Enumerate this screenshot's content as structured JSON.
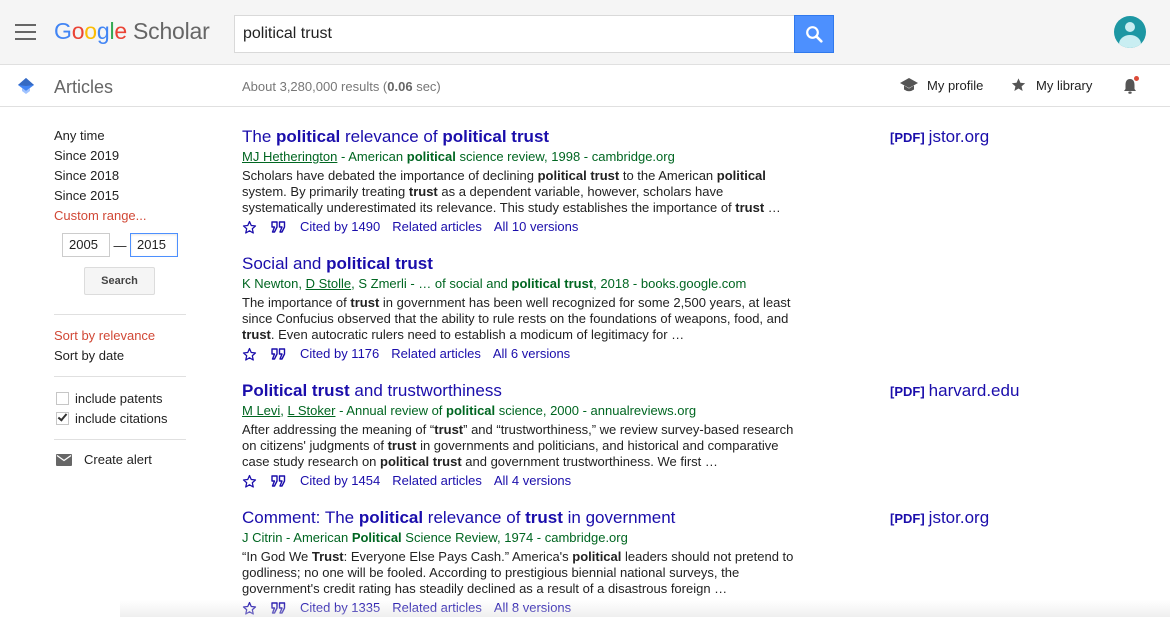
{
  "header": {
    "logo_google": [
      "G",
      "o",
      "o",
      "g",
      "l",
      "e"
    ],
    "logo_scholar": "Scholar",
    "search_value": "political trust"
  },
  "subbar": {
    "section": "Articles",
    "results_prefix": "About 3,280,000 results (",
    "results_time": "0.06",
    "results_suffix": " sec)",
    "my_profile": "My profile",
    "my_library": "My library"
  },
  "sidebar": {
    "time_filters": [
      "Any time",
      "Since 2019",
      "Since 2018",
      "Since 2015"
    ],
    "custom_range": "Custom range...",
    "year_from": "2005",
    "year_to": "2015",
    "search_button": "Search",
    "sort_relevance": "Sort by relevance",
    "sort_date": "Sort by date",
    "include_patents": "include patents",
    "include_patents_checked": false,
    "include_citations": "include citations",
    "include_citations_checked": true,
    "create_alert": "Create alert"
  },
  "results": [
    {
      "title": [
        [
          "The ",
          false
        ],
        [
          "political",
          true
        ],
        [
          " relevance of ",
          false
        ],
        [
          "political trust",
          true
        ]
      ],
      "meta": [
        [
          "MJ Hetherington",
          "u"
        ],
        [
          " - American ",
          ""
        ],
        [
          "political",
          "b"
        ],
        [
          " science review, 1998 - cambridge.org",
          ""
        ]
      ],
      "snippet": [
        [
          "Scholars have debated the importance of declining ",
          false
        ],
        [
          "political trust",
          true
        ],
        [
          " to the American ",
          false
        ],
        [
          "political",
          true
        ],
        [
          " system. By primarily treating ",
          false
        ],
        [
          "trust",
          true
        ],
        [
          " as a dependent variable, however, scholars have systematically underestimated its relevance. This study establishes the importance of ",
          false
        ],
        [
          "trust",
          true
        ],
        [
          " …",
          false
        ]
      ],
      "cited_by": "Cited by 1490",
      "related": "Related articles",
      "versions": "All 10 versions",
      "pdf_tag": "[PDF]",
      "pdf_source": "jstor.org"
    },
    {
      "title": [
        [
          "Social and ",
          false
        ],
        [
          "political trust",
          true
        ]
      ],
      "meta": [
        [
          "K Newton",
          ""
        ],
        [
          ", ",
          ""
        ],
        [
          "D Stolle",
          "u"
        ],
        [
          ", S Zmerli - … of social and ",
          ""
        ],
        [
          "political trust",
          "b"
        ],
        [
          ", 2018 - books.google.com",
          ""
        ]
      ],
      "snippet": [
        [
          "The importance of ",
          false
        ],
        [
          "trust",
          true
        ],
        [
          " in government has been well recognized for some 2,500 years, at least since Confucius observed that the ability to rule rests on the foundations of weapons, food, and ",
          false
        ],
        [
          "trust",
          true
        ],
        [
          ". Even autocratic rulers need to establish a modicum of legitimacy for …",
          false
        ]
      ],
      "cited_by": "Cited by 1176",
      "related": "Related articles",
      "versions": "All 6 versions",
      "pdf_tag": "",
      "pdf_source": ""
    },
    {
      "title": [
        [
          "Political trust",
          true
        ],
        [
          " and trustworthiness",
          false
        ]
      ],
      "meta": [
        [
          "M Levi",
          "u"
        ],
        [
          ", ",
          ""
        ],
        [
          "L Stoker",
          "u"
        ],
        [
          " - Annual review of ",
          ""
        ],
        [
          "political",
          "b"
        ],
        [
          " science, 2000 - annualreviews.org",
          ""
        ]
      ],
      "snippet": [
        [
          "After addressing the meaning of “",
          false
        ],
        [
          "trust",
          true
        ],
        [
          "” and “trustworthiness,” we review survey-based research on citizens' judgments of ",
          false
        ],
        [
          "trust",
          true
        ],
        [
          " in governments and politicians, and historical and comparative case study research on ",
          false
        ],
        [
          "political trust",
          true
        ],
        [
          " and government trustworthiness. We first …",
          false
        ]
      ],
      "cited_by": "Cited by 1454",
      "related": "Related articles",
      "versions": "All 4 versions",
      "pdf_tag": "[PDF]",
      "pdf_source": "harvard.edu"
    },
    {
      "title": [
        [
          "Comment: The ",
          false
        ],
        [
          "political",
          true
        ],
        [
          " relevance of ",
          false
        ],
        [
          "trust",
          true
        ],
        [
          " in government",
          false
        ]
      ],
      "meta": [
        [
          "J Citrin - American ",
          ""
        ],
        [
          "Political",
          "b"
        ],
        [
          " Science Review, 1974 - cambridge.org",
          ""
        ]
      ],
      "snippet": [
        [
          "“In God We ",
          false
        ],
        [
          "Trust",
          true
        ],
        [
          ": Everyone Else Pays Cash.” America's ",
          false
        ],
        [
          "political",
          true
        ],
        [
          " leaders should not pretend to godliness; no one will be fooled. According to prestigious biennial national surveys, the government's credit rating has steadily declined as a result of a disastrous foreign …",
          false
        ]
      ],
      "cited_by": "Cited by 1335",
      "related": "Related articles",
      "versions": "All 8 versions",
      "pdf_tag": "[PDF]",
      "pdf_source": "jstor.org"
    }
  ],
  "colors": {
    "link": "#1a0dab",
    "meta_green": "#006621",
    "accent_red": "#d14836",
    "search_blue": "#4d90fe"
  },
  "icons": {
    "menu": "hamburger-icon",
    "search": "search-icon",
    "cap": "scholar-cap-icon",
    "profile": "graduation-cap-icon",
    "library": "star-icon",
    "bell": "bell-icon",
    "save": "star-outline-icon",
    "cite": "quote-icon",
    "alert": "mail-icon"
  }
}
